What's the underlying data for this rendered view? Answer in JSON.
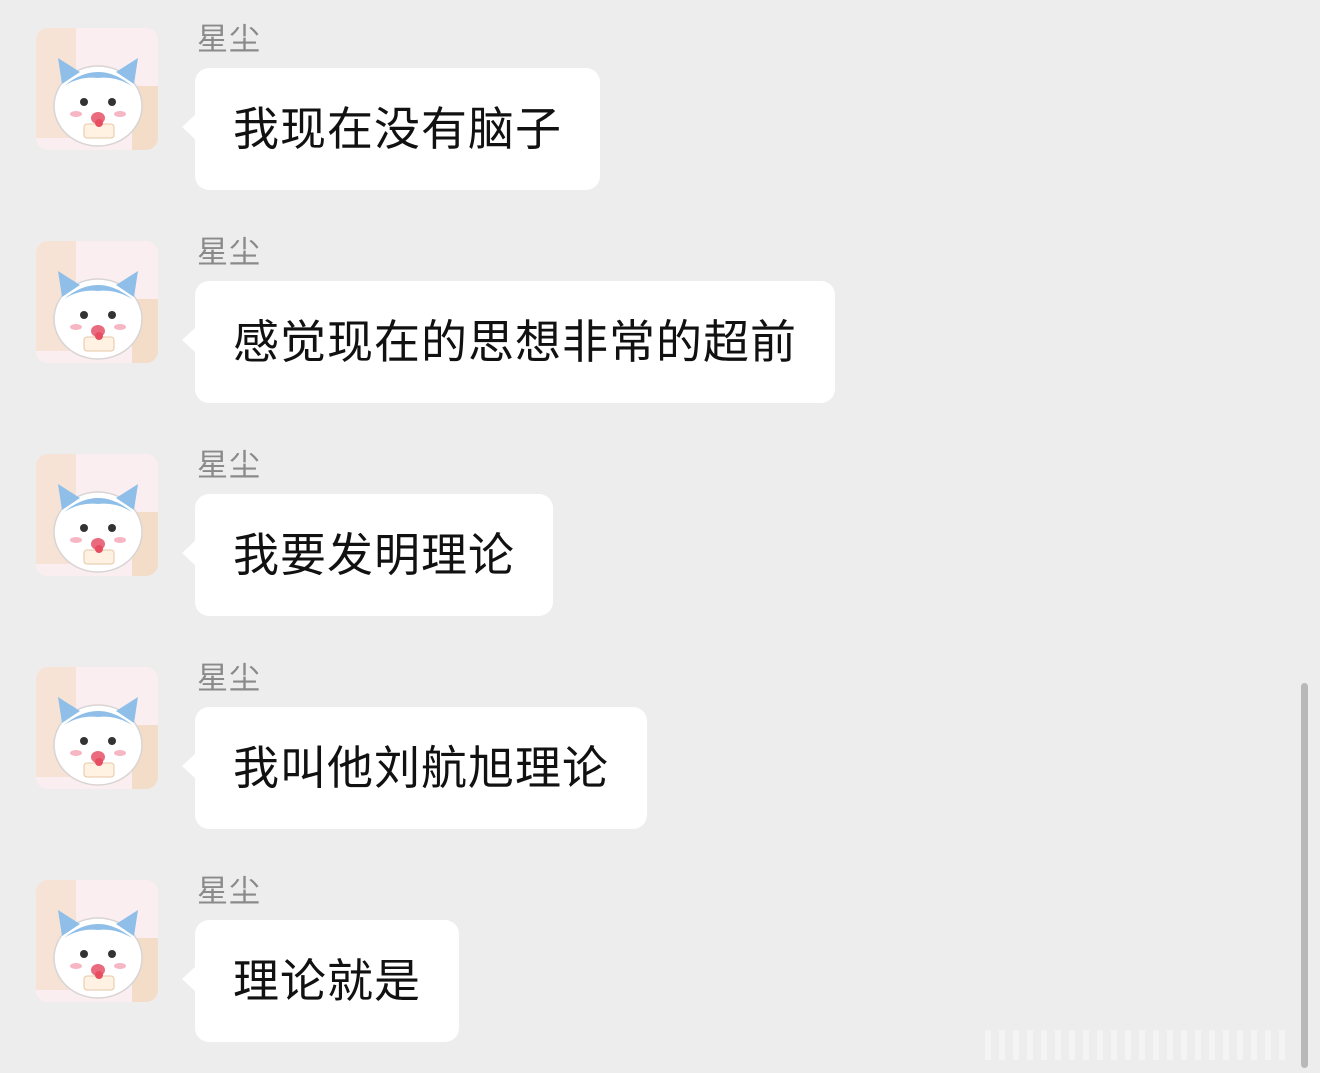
{
  "messages": [
    {
      "sender": "星尘",
      "text": "我现在没有脑子"
    },
    {
      "sender": "星尘",
      "text": "感觉现在的思想非常的超前"
    },
    {
      "sender": "星尘",
      "text": "我要发明理论"
    },
    {
      "sender": "星尘",
      "text": "我叫他刘航旭理论"
    },
    {
      "sender": "星尘",
      "text": "理论就是"
    }
  ],
  "avatar": {
    "icon": "cat-eating-cake-icon"
  },
  "colors": {
    "background": "#ededed",
    "bubble": "#ffffff",
    "sender_name": "#8a8a8a",
    "message_text": "#111111",
    "avatar_hair": "#8fbfe8"
  }
}
